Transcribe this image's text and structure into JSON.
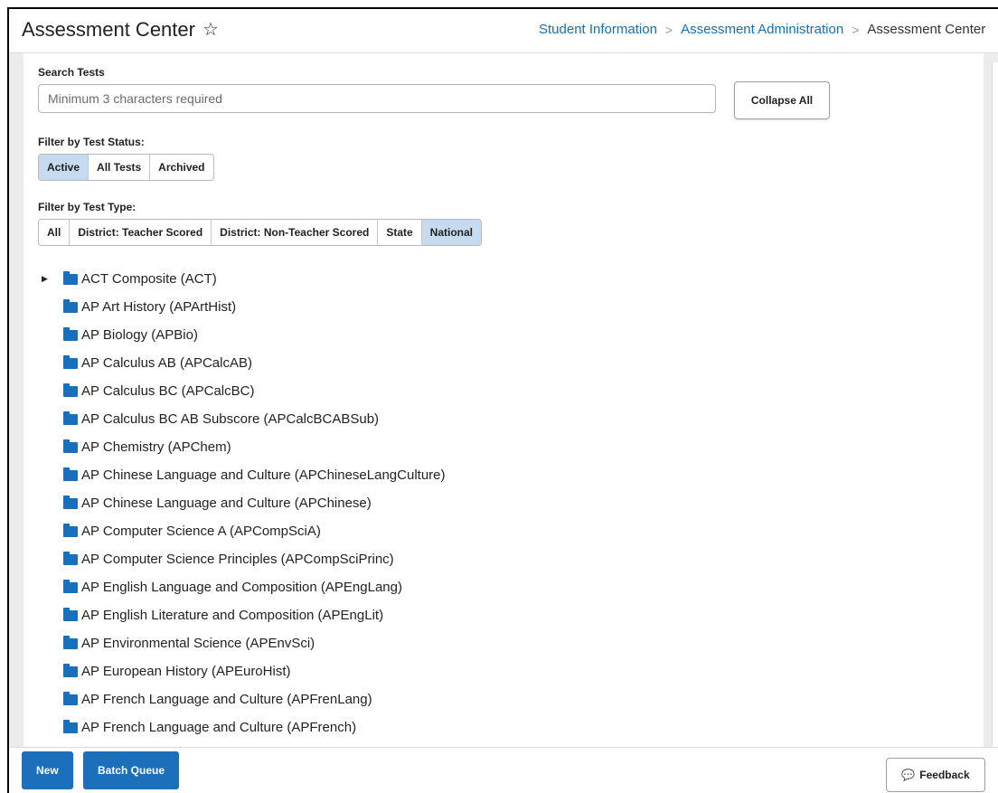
{
  "header": {
    "title": "Assessment Center",
    "star_icon": "☆",
    "breadcrumb": {
      "items": [
        "Student Information",
        "Assessment Administration"
      ],
      "current": "Assessment Center"
    }
  },
  "search": {
    "label": "Search Tests",
    "placeholder": "Minimum 3 characters required",
    "value": "",
    "collapse_label": "Collapse All"
  },
  "status_filter": {
    "label": "Filter by Test Status:",
    "options": [
      "Active",
      "All Tests",
      "Archived"
    ],
    "selected": "Active"
  },
  "type_filter": {
    "label": "Filter by Test Type:",
    "options": [
      "All",
      "District: Teacher Scored",
      "District: Non-Teacher Scored",
      "State",
      "National"
    ],
    "selected": "National"
  },
  "tests": [
    "ACT Composite (ACT)",
    "AP Art History (APArtHist)",
    "AP Biology (APBio)",
    "AP Calculus AB (APCalcAB)",
    "AP Calculus BC (APCalcBC)",
    "AP Calculus BC AB Subscore (APCalcBCABSub)",
    "AP Chemistry (APChem)",
    "AP Chinese Language and Culture (APChineseLangCulture)",
    "AP Chinese Language and Culture (APChinese)",
    "AP Computer Science A (APCompSciA)",
    "AP Computer Science Principles (APCompSciPrinc)",
    "AP English Language and Composition (APEngLang)",
    "AP English Literature and Composition (APEngLit)",
    "AP Environmental Science (APEnvSci)",
    "AP European History (APEuroHist)",
    "AP French Language and Culture (APFrenLang)",
    "AP French Language and Culture (APFrench)"
  ],
  "footer": {
    "new_label": "New",
    "batch_label": "Batch Queue",
    "feedback_label": "Feedback"
  },
  "colors": {
    "accent": "#1c6fba",
    "link": "#1570b8",
    "selected_segment": "#c6dbef",
    "folder": "#1a6fbd"
  }
}
